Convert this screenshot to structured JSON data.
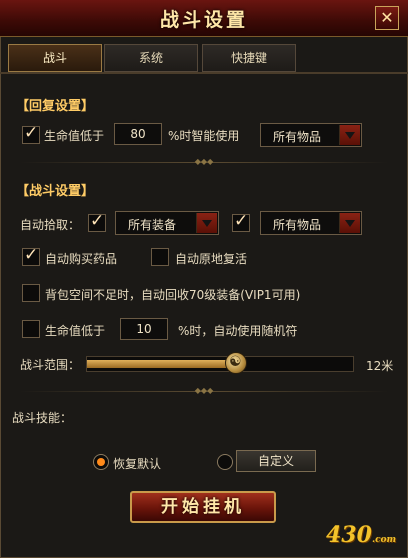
{
  "window": {
    "title": "战斗设置",
    "close_glyph": "✕"
  },
  "tabs": [
    {
      "label": "战斗",
      "active": true
    },
    {
      "label": "系统",
      "active": false
    },
    {
      "label": "快捷键",
      "active": false
    }
  ],
  "recovery": {
    "header": "【回复设置】",
    "hp_label": "生命值低于",
    "hp_checked": true,
    "hp_value": "80",
    "hp_suffix": "%时智能使用",
    "item_select": "所有物品"
  },
  "combat": {
    "header": "【战斗设置】",
    "auto_pickup_label": "自动拾取：",
    "pickup1_checked": true,
    "pickup1_select": "所有装备",
    "pickup2_checked": true,
    "pickup2_select": "所有物品",
    "auto_buy_label": "自动购买药品",
    "auto_buy_checked": true,
    "auto_revive_label": "自动原地复活",
    "auto_revive_checked": false,
    "recycle_label": "背包空间不足时，自动回收70级装备(VIP1可用)",
    "recycle_checked": false,
    "hp2_label": "生命值低于",
    "hp2_checked": false,
    "hp2_value": "10",
    "hp2_suffix": "%时，自动使用随机符",
    "range_label": "战斗范围：",
    "range_value_text": "12米",
    "range_fraction": 0.56
  },
  "skills": {
    "label": "战斗技能：",
    "restore_label": "恢复默认",
    "restore_selected": true,
    "custom_selected": false,
    "custom_button": "自定义"
  },
  "start_button": "开始挂机",
  "watermark": {
    "main": "430",
    "suffix": ".com"
  },
  "colors": {
    "accent": "#ffcc66",
    "frame_red": "#6a1510",
    "radio_on": "#ff8a1a"
  }
}
